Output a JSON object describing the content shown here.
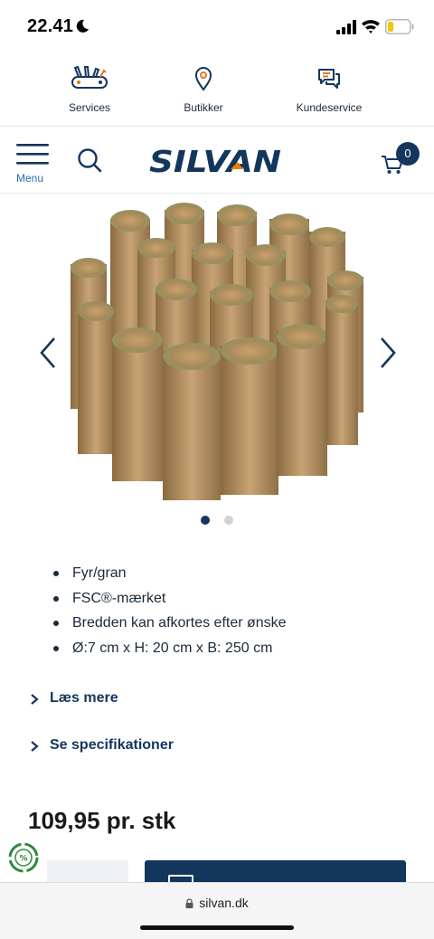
{
  "status_bar": {
    "time": "22.41"
  },
  "top_links": [
    {
      "label": "Services",
      "icon": "tools-icon"
    },
    {
      "label": "Butikker",
      "icon": "location-pin-icon"
    },
    {
      "label": "Kundeservice",
      "icon": "chat-bubbles-icon"
    }
  ],
  "header": {
    "menu_label": "Menu",
    "logo_text": "SILVAN",
    "cart_count": "0"
  },
  "gallery": {
    "total_images": 2,
    "active_index": 0
  },
  "features": [
    "Fyr/gran",
    "FSC®-mærket",
    "Bredden kan afkortes efter ønske",
    "Ø:7 cm x H: 20 cm x B: 250 cm"
  ],
  "expanders": {
    "read_more": "Læs mere",
    "specifications": "Se specifikationer"
  },
  "price": "109,95 pr. stk",
  "browser": {
    "url": "silvan.dk"
  },
  "colors": {
    "brand_navy": "#13365c",
    "logo_orange": "#f07d00",
    "link_blue": "#2a6db0"
  }
}
